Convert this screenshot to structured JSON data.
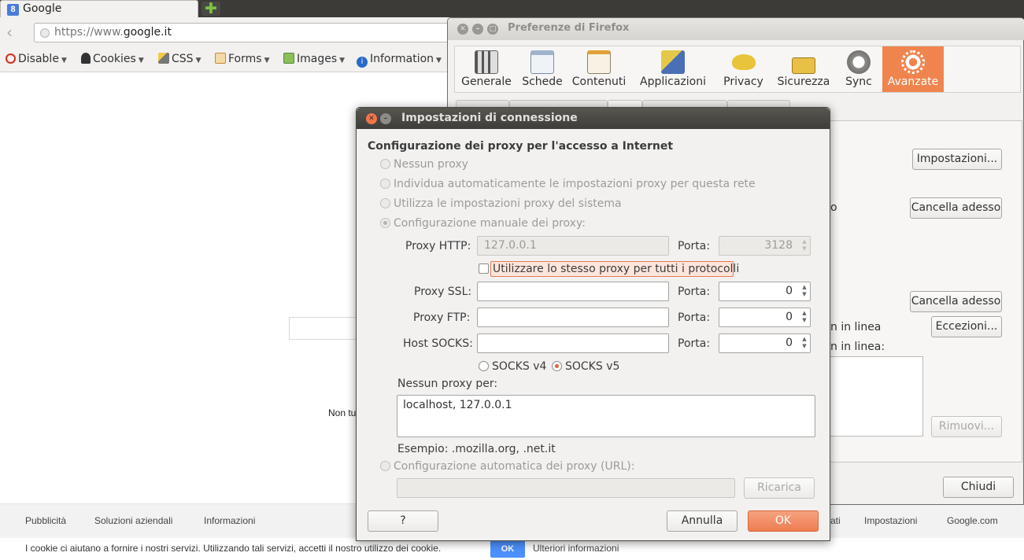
{
  "browser": {
    "tab_title": "Google",
    "tab_favicon_letter": "8",
    "new_tab_symbol": "✚",
    "url_prefix": "https://www.",
    "url_domain": "google.it",
    "devbar": [
      {
        "label": "Disable",
        "icon": "no-entry-icon",
        "color": "#d92b1c"
      },
      {
        "label": "Cookies",
        "icon": "person-icon",
        "color": "#333333"
      },
      {
        "label": "CSS",
        "icon": "magic-wand-icon",
        "color": "#d9a531"
      },
      {
        "label": "Forms",
        "icon": "forms-icon",
        "color": "#c98a3a"
      },
      {
        "label": "Images",
        "icon": "image-icon",
        "color": "#5a8a3a"
      },
      {
        "label": "Information",
        "icon": "info-icon",
        "color": "#2a6bc9"
      }
    ],
    "page_partial_text": "Non tu",
    "footer_left": [
      "Pubblicità",
      "Soluzioni aziendali",
      "Informazioni"
    ],
    "footer_right": [
      "ati",
      "Impostazioni",
      "Google.com"
    ],
    "cookie_text": "I cookie ci aiutano a fornire i nostri servizi. Utilizzando tali servizi, accetti il nostro utilizzo dei cookie.",
    "cookie_ok": "OK",
    "cookie_more": "Ulteriori informazioni"
  },
  "prefs": {
    "title": "Preferenze di Firefox",
    "tabs": [
      {
        "label": "Generale",
        "icon": "switches-icon"
      },
      {
        "label": "Schede",
        "icon": "tabs-icon"
      },
      {
        "label": "Contenuti",
        "icon": "content-icon"
      },
      {
        "label": "Applicazioni",
        "icon": "scissors-icon"
      },
      {
        "label": "Privacy",
        "icon": "mask-icon"
      },
      {
        "label": "Sicurezza",
        "icon": "padlock-icon"
      },
      {
        "label": "Sync",
        "icon": "sync-icon"
      },
      {
        "label": "Avanzate",
        "icon": "gear-icon",
        "selected": true
      }
    ],
    "btn_impostazioni": "Impostazioni...",
    "btn_cancella1": "Cancella adesso",
    "btn_cancella2": "Cancella adesso",
    "btn_eccezioni": "Eccezioni...",
    "btn_rimuovi": "Rimuovi...",
    "btn_chiudi": "Chiudi",
    "partial_o": "o",
    "partial_inlinea1": "n in linea",
    "partial_inlinea2": "n in linea:"
  },
  "dialog": {
    "title": "Impostazioni di connessione",
    "heading": "Configurazione dei proxy per l'accesso a Internet",
    "opt_none": "Nessun proxy",
    "opt_auto_detect": "Individua automaticamente le impostazioni proxy per questa rete",
    "opt_system": "Utilizza le impostazioni proxy del sistema",
    "opt_manual": "Configurazione manuale dei proxy:",
    "http_label": "Proxy HTTP:",
    "http_value": "127.0.0.1",
    "http_port_label": "Porta:",
    "http_port": "3128",
    "same_proxy_label": "Utilizzare lo stesso proxy per tutti i protocolli",
    "ssl_label": "Proxy SSL:",
    "ssl_value": "",
    "ssl_port_label": "Porta:",
    "ssl_port": "0",
    "ftp_label": "Proxy FTP:",
    "ftp_value": "",
    "ftp_port_label": "Porta:",
    "ftp_port": "0",
    "socks_label": "Host SOCKS:",
    "socks_value": "",
    "socks_port_label": "Porta:",
    "socks_port": "0",
    "socks_v4": "SOCKS v4",
    "socks_v5": "SOCKS v5",
    "no_proxy_label": "Nessun proxy per:",
    "no_proxy_value": "localhost, 127.0.0.1",
    "example": "Esempio: .mozilla.org, .net.it",
    "opt_pac": "Configurazione automatica dei proxy (URL):",
    "pac_value": "",
    "btn_reload": "Ricarica",
    "btn_help": "?",
    "btn_cancel": "Annulla",
    "btn_ok": "OK",
    "selected_option": "manual",
    "accent_color": "#f0764a"
  }
}
